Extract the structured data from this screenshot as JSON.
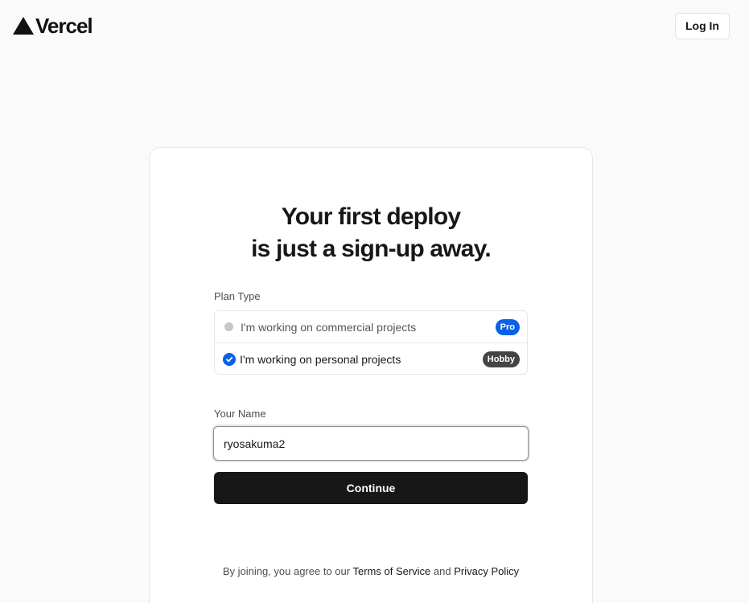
{
  "header": {
    "brand_name": "Vercel",
    "login_label": "Log In"
  },
  "card": {
    "headline_line1": "Your first deploy",
    "headline_line2": "is just a sign-up away.",
    "plan_type_label": "Plan Type",
    "plans": [
      {
        "label": "I'm working on commercial projects",
        "badge": "Pro",
        "selected": false
      },
      {
        "label": "I'm working on personal projects",
        "badge": "Hobby",
        "selected": true
      }
    ],
    "name_label": "Your Name",
    "name_value": "ryosakuma2",
    "continue_label": "Continue",
    "legal_prefix": "By joining, you agree to our",
    "terms_label": "Terms of Service",
    "legal_and": "and",
    "privacy_label": "Privacy Policy"
  },
  "colors": {
    "accent_blue": "#0a61e5",
    "hobby_badge": "#444444",
    "primary_button": "#171717",
    "page_background": "#fafafa"
  },
  "icons": {
    "brand": "vercel-triangle-icon",
    "selected_radio": "checkmark-icon"
  }
}
